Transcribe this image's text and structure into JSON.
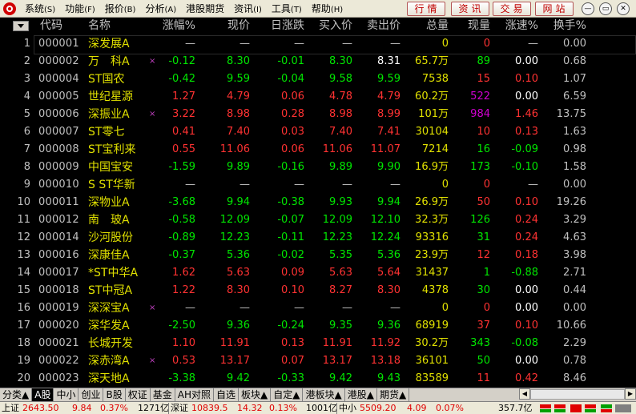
{
  "menu": {
    "items": [
      {
        "label": "系统",
        "key": "(S)"
      },
      {
        "label": "功能",
        "key": "(F)"
      },
      {
        "label": "报价",
        "key": "(B)"
      },
      {
        "label": "分析",
        "key": "(A)"
      },
      {
        "label": "港股期货",
        "key": ""
      },
      {
        "label": "资讯",
        "key": "(I)"
      },
      {
        "label": "工具",
        "key": "(T)"
      },
      {
        "label": "帮助",
        "key": "(H)"
      }
    ],
    "buttons": [
      "行情",
      "资讯",
      "交易",
      "网站"
    ]
  },
  "columns": [
    "代码",
    "名称",
    "涨幅%",
    "现价",
    "日涨跌",
    "买入价",
    "卖出价",
    "总量",
    "现量",
    "涨速%",
    "换手%"
  ],
  "rows": [
    {
      "idx": "1",
      "code": "000001",
      "name": "深发展A",
      "mark": "",
      "pct": "—",
      "price": "—",
      "chg": "—",
      "buy": "—",
      "sell": "—",
      "vol": "0",
      "cur": "0",
      "spd": "—",
      "turn": "0.00",
      "dir": "fl",
      "curColor": "up",
      "spdColor": "fl",
      "sellColor": "fl"
    },
    {
      "idx": "2",
      "code": "000002",
      "name": "万　科A",
      "mark": "×",
      "pct": "-0.12",
      "price": "8.30",
      "chg": "-0.01",
      "buy": "8.30",
      "sell": "8.31",
      "vol": "65.7万",
      "cur": "89",
      "spd": "0.00",
      "turn": "0.68",
      "dir": "dn",
      "curColor": "dn",
      "spdColor": "wh",
      "sellColor": "wh"
    },
    {
      "idx": "3",
      "code": "000004",
      "name": "ST国农",
      "mark": "",
      "pct": "-0.42",
      "price": "9.59",
      "chg": "-0.04",
      "buy": "9.58",
      "sell": "9.59",
      "vol": "7538",
      "cur": "15",
      "spd": "0.10",
      "turn": "1.07",
      "dir": "dn",
      "curColor": "up",
      "spdColor": "up",
      "sellColor": "dn"
    },
    {
      "idx": "4",
      "code": "000005",
      "name": "世纪星源",
      "mark": "",
      "pct": "1.27",
      "price": "4.79",
      "chg": "0.06",
      "buy": "4.78",
      "sell": "4.79",
      "vol": "60.2万",
      "cur": "522",
      "spd": "0.00",
      "turn": "6.59",
      "dir": "up",
      "curColor": "mg",
      "spdColor": "wh",
      "sellColor": "up"
    },
    {
      "idx": "5",
      "code": "000006",
      "name": "深振业A",
      "mark": "×",
      "pct": "3.22",
      "price": "8.98",
      "chg": "0.28",
      "buy": "8.98",
      "sell": "8.99",
      "vol": "101万",
      "cur": "984",
      "spd": "1.46",
      "turn": "13.75",
      "dir": "up",
      "curColor": "mg",
      "spdColor": "up",
      "sellColor": "up"
    },
    {
      "idx": "6",
      "code": "000007",
      "name": "ST零七",
      "mark": "",
      "pct": "0.41",
      "price": "7.40",
      "chg": "0.03",
      "buy": "7.40",
      "sell": "7.41",
      "vol": "30104",
      "cur": "10",
      "spd": "0.13",
      "turn": "1.63",
      "dir": "up",
      "curColor": "up",
      "spdColor": "up",
      "sellColor": "up"
    },
    {
      "idx": "7",
      "code": "000008",
      "name": "ST宝利来",
      "mark": "",
      "pct": "0.55",
      "price": "11.06",
      "chg": "0.06",
      "buy": "11.06",
      "sell": "11.07",
      "vol": "7214",
      "cur": "16",
      "spd": "-0.09",
      "turn": "0.98",
      "dir": "up",
      "curColor": "dn",
      "spdColor": "dn",
      "sellColor": "up"
    },
    {
      "idx": "8",
      "code": "000009",
      "name": "中国宝安",
      "mark": "",
      "pct": "-1.59",
      "price": "9.89",
      "chg": "-0.16",
      "buy": "9.89",
      "sell": "9.90",
      "vol": "16.9万",
      "cur": "173",
      "spd": "-0.10",
      "turn": "1.58",
      "dir": "dn",
      "curColor": "dn",
      "spdColor": "dn",
      "sellColor": "dn"
    },
    {
      "idx": "9",
      "code": "000010",
      "name": "S ST华新",
      "mark": "",
      "pct": "—",
      "price": "—",
      "chg": "—",
      "buy": "—",
      "sell": "—",
      "vol": "0",
      "cur": "0",
      "spd": "—",
      "turn": "0.00",
      "dir": "fl",
      "curColor": "up",
      "spdColor": "fl",
      "sellColor": "fl"
    },
    {
      "idx": "10",
      "code": "000011",
      "name": "深物业A",
      "mark": "",
      "pct": "-3.68",
      "price": "9.94",
      "chg": "-0.38",
      "buy": "9.93",
      "sell": "9.94",
      "vol": "26.9万",
      "cur": "50",
      "spd": "0.10",
      "turn": "19.26",
      "dir": "dn",
      "curColor": "up",
      "spdColor": "up",
      "sellColor": "dn"
    },
    {
      "idx": "11",
      "code": "000012",
      "name": "南　玻A",
      "mark": "",
      "pct": "-0.58",
      "price": "12.09",
      "chg": "-0.07",
      "buy": "12.09",
      "sell": "12.10",
      "vol": "32.3万",
      "cur": "126",
      "spd": "0.24",
      "turn": "3.29",
      "dir": "dn",
      "curColor": "dn",
      "spdColor": "up",
      "sellColor": "dn"
    },
    {
      "idx": "12",
      "code": "000014",
      "name": "沙河股份",
      "mark": "",
      "pct": "-0.89",
      "price": "12.23",
      "chg": "-0.11",
      "buy": "12.23",
      "sell": "12.24",
      "vol": "93316",
      "cur": "31",
      "spd": "0.24",
      "turn": "4.63",
      "dir": "dn",
      "curColor": "dn",
      "spdColor": "up",
      "sellColor": "dn"
    },
    {
      "idx": "13",
      "code": "000016",
      "name": "深康佳A",
      "mark": "",
      "pct": "-0.37",
      "price": "5.36",
      "chg": "-0.02",
      "buy": "5.35",
      "sell": "5.36",
      "vol": "23.9万",
      "cur": "12",
      "spd": "0.18",
      "turn": "3.98",
      "dir": "dn",
      "curColor": "up",
      "spdColor": "up",
      "sellColor": "dn"
    },
    {
      "idx": "14",
      "code": "000017",
      "name": "*ST中华A",
      "mark": "",
      "pct": "1.62",
      "price": "5.63",
      "chg": "0.09",
      "buy": "5.63",
      "sell": "5.64",
      "vol": "31437",
      "cur": "1",
      "spd": "-0.88",
      "turn": "2.71",
      "dir": "up",
      "curColor": "dn",
      "spdColor": "dn",
      "sellColor": "up"
    },
    {
      "idx": "15",
      "code": "000018",
      "name": "ST中冠A",
      "mark": "",
      "pct": "1.22",
      "price": "8.30",
      "chg": "0.10",
      "buy": "8.27",
      "sell": "8.30",
      "vol": "4378",
      "cur": "30",
      "spd": "0.00",
      "turn": "0.44",
      "dir": "up",
      "curColor": "dn",
      "spdColor": "wh",
      "sellColor": "up"
    },
    {
      "idx": "16",
      "code": "000019",
      "name": "深深宝A",
      "mark": "×",
      "pct": "—",
      "price": "—",
      "chg": "—",
      "buy": "—",
      "sell": "—",
      "vol": "0",
      "cur": "0",
      "spd": "0.00",
      "turn": "0.00",
      "dir": "fl",
      "curColor": "up",
      "spdColor": "wh",
      "sellColor": "fl"
    },
    {
      "idx": "17",
      "code": "000020",
      "name": "深华发A",
      "mark": "",
      "pct": "-2.50",
      "price": "9.36",
      "chg": "-0.24",
      "buy": "9.35",
      "sell": "9.36",
      "vol": "68919",
      "cur": "37",
      "spd": "0.10",
      "turn": "10.66",
      "dir": "dn",
      "curColor": "up",
      "spdColor": "up",
      "sellColor": "dn"
    },
    {
      "idx": "18",
      "code": "000021",
      "name": "长城开发",
      "mark": "",
      "pct": "1.10",
      "price": "11.91",
      "chg": "0.13",
      "buy": "11.91",
      "sell": "11.92",
      "vol": "30.2万",
      "cur": "343",
      "spd": "-0.08",
      "turn": "2.29",
      "dir": "up",
      "curColor": "dn",
      "spdColor": "dn",
      "sellColor": "up"
    },
    {
      "idx": "19",
      "code": "000022",
      "name": "深赤湾A",
      "mark": "×",
      "pct": "0.53",
      "price": "13.17",
      "chg": "0.07",
      "buy": "13.17",
      "sell": "13.18",
      "vol": "36101",
      "cur": "50",
      "spd": "0.00",
      "turn": "0.78",
      "dir": "up",
      "curColor": "dn",
      "spdColor": "wh",
      "sellColor": "up"
    },
    {
      "idx": "20",
      "code": "000023",
      "name": "深天地A",
      "mark": "",
      "pct": "-3.38",
      "price": "9.42",
      "chg": "-0.33",
      "buy": "9.42",
      "sell": "9.43",
      "vol": "83589",
      "cur": "11",
      "spd": "0.42",
      "turn": "8.46",
      "dir": "dn",
      "curColor": "up",
      "spdColor": "up",
      "sellColor": "dn"
    }
  ],
  "tabs": [
    "分类▲",
    "A股",
    "中小",
    "创业",
    "B股",
    "权证",
    "基金",
    "AH对照",
    "自选",
    "板块▲",
    "自定▲",
    "港板块▲",
    "港股▲",
    "期货▲"
  ],
  "active_tab": "A股",
  "status": {
    "sh_label": "上证",
    "sh_value": "2643.50",
    "sh_chg": "9.84",
    "sh_pct": "0.37%",
    "sh_amount": "1271亿",
    "sz_label": "深证",
    "sz_value": "10839.5",
    "sz_chg": "14.32",
    "sz_pct": "0.13%",
    "sz_amount": "1001亿",
    "zx_label": "中小",
    "zx_value": "5509.20",
    "zx_chg": "4.09",
    "zx_pct": "0.07%",
    "zx_amount": "357.7亿"
  },
  "colors": {
    "up": "#ff3232",
    "down": "#00e600",
    "flat": "#c0c0c0",
    "name": "#e0e000",
    "accent": "#c00000"
  }
}
